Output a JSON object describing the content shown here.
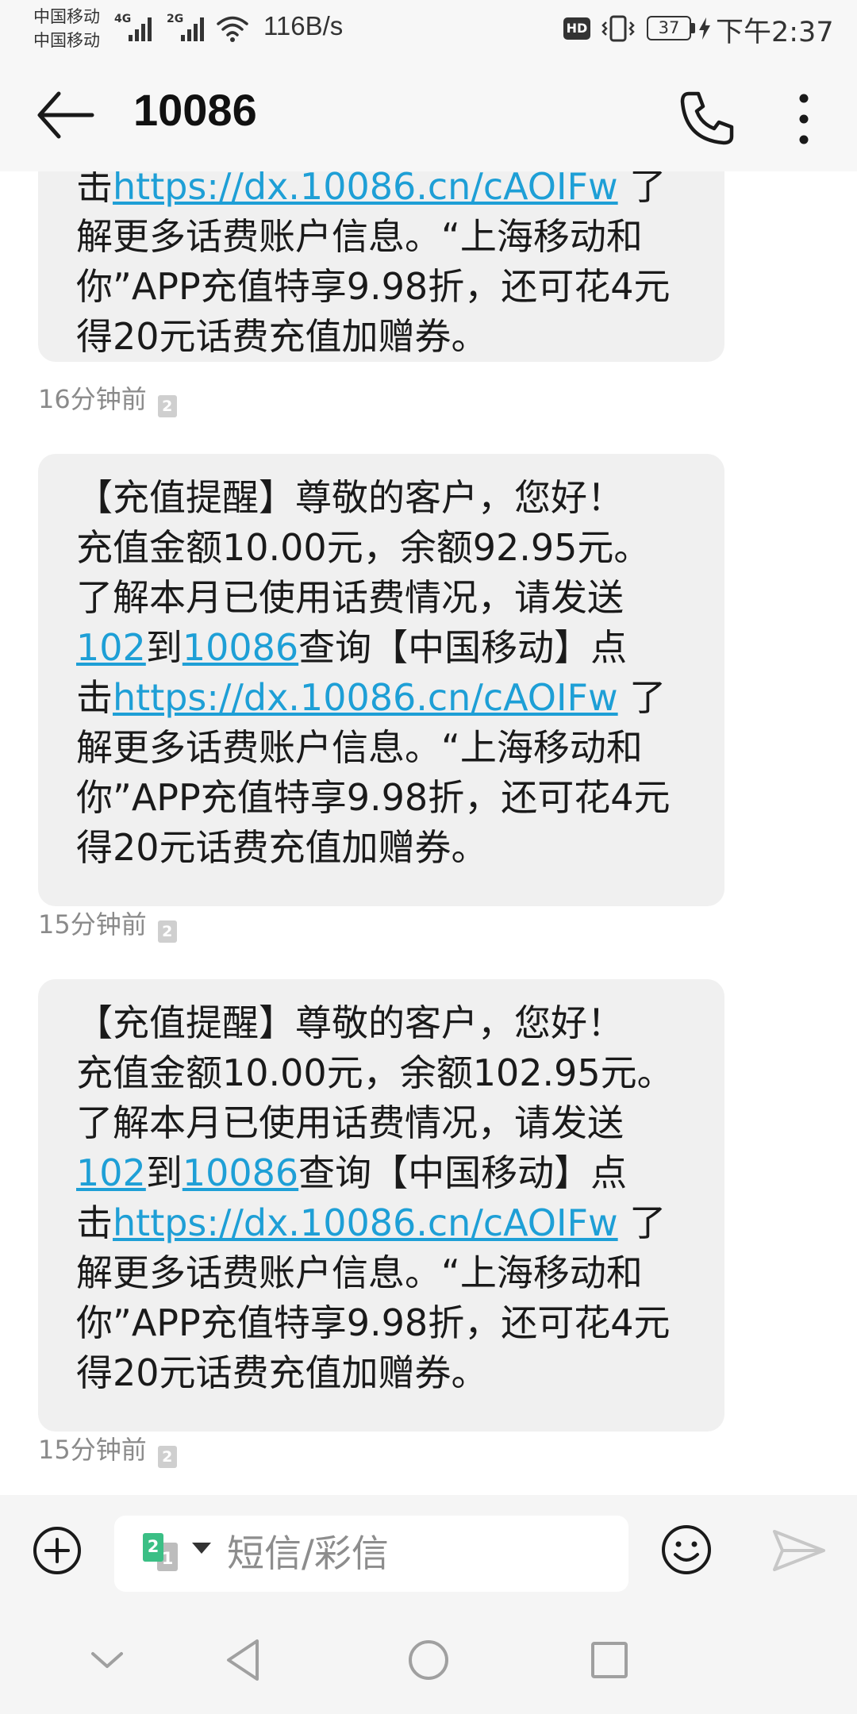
{
  "status_bar": {
    "carrier_1": "中国移动",
    "carrier_2": "中国移动",
    "sim1_network": "4G",
    "sim2_network": "2G",
    "speed": "116B/s",
    "hd_label": "HD",
    "battery": "37",
    "time": "下午2:37"
  },
  "header": {
    "title": "10086",
    "icons": {
      "back": "back-arrow-icon",
      "call": "phone-icon",
      "more": "more-vertical-icon"
    }
  },
  "messages": [
    {
      "lines": [
        [
          {
            "t": "击"
          },
          {
            "t": "https://dx.10086.cn/cAOIFw",
            "link": true
          },
          {
            "t": " 了"
          }
        ],
        [
          {
            "t": "解更多话费账户信息。“上海移动和"
          }
        ],
        [
          {
            "t": "你”APP充值特享9.98折，还可花4元"
          }
        ],
        [
          {
            "t": "得20元话费充值加赠券。"
          }
        ]
      ],
      "time": "16分钟前",
      "sim": "2"
    },
    {
      "lines": [
        [
          {
            "t": "【充值提醒】尊敬的客户，您好！"
          }
        ],
        [
          {
            "t": "充值金额10.00元，余额92.95元。"
          }
        ],
        [
          {
            "t": "了解本月已使用话费情况，请发送"
          }
        ],
        [
          {
            "t": "102",
            "link": true
          },
          {
            "t": "到"
          },
          {
            "t": "10086",
            "link": true
          },
          {
            "t": "查询【中国移动】点"
          }
        ],
        [
          {
            "t": "击"
          },
          {
            "t": "https://dx.10086.cn/cAOIFw",
            "link": true
          },
          {
            "t": " 了"
          }
        ],
        [
          {
            "t": "解更多话费账户信息。“上海移动和"
          }
        ],
        [
          {
            "t": "你”APP充值特享9.98折，还可花4元"
          }
        ],
        [
          {
            "t": "得20元话费充值加赠券。"
          }
        ]
      ],
      "time": "15分钟前",
      "sim": "2"
    },
    {
      "lines": [
        [
          {
            "t": "【充值提醒】尊敬的客户，您好！"
          }
        ],
        [
          {
            "t": "充值金额10.00元，余额102.95元。"
          }
        ],
        [
          {
            "t": "了解本月已使用话费情况，请发送"
          }
        ],
        [
          {
            "t": "102",
            "link": true
          },
          {
            "t": "到"
          },
          {
            "t": "10086",
            "link": true
          },
          {
            "t": "查询【中国移动】点"
          }
        ],
        [
          {
            "t": "击"
          },
          {
            "t": "https://dx.10086.cn/cAOIFw",
            "link": true
          },
          {
            "t": " 了"
          }
        ],
        [
          {
            "t": "解更多话费账户信息。“上海移动和"
          }
        ],
        [
          {
            "t": "你”APP充值特享9.98折，还可花4元"
          }
        ],
        [
          {
            "t": "得20元话费充值加赠券。"
          }
        ]
      ],
      "time": "15分钟前",
      "sim": "2"
    }
  ],
  "compose": {
    "placeholder": "短信/彩信",
    "sim_front": "2",
    "sim_back": "1",
    "icons": {
      "add": "add-circle-icon",
      "emoji": "emoji-icon",
      "send": "send-icon"
    }
  },
  "navbar": {
    "icons": [
      "chevron-down-icon",
      "back-triangle-icon",
      "home-circle-icon",
      "recents-square-icon"
    ]
  },
  "colors": {
    "link": "#1e9fd6",
    "bubble": "#f0f0f0",
    "bar_bg": "#f7f7f7",
    "sim_green": "#3bbf85"
  }
}
